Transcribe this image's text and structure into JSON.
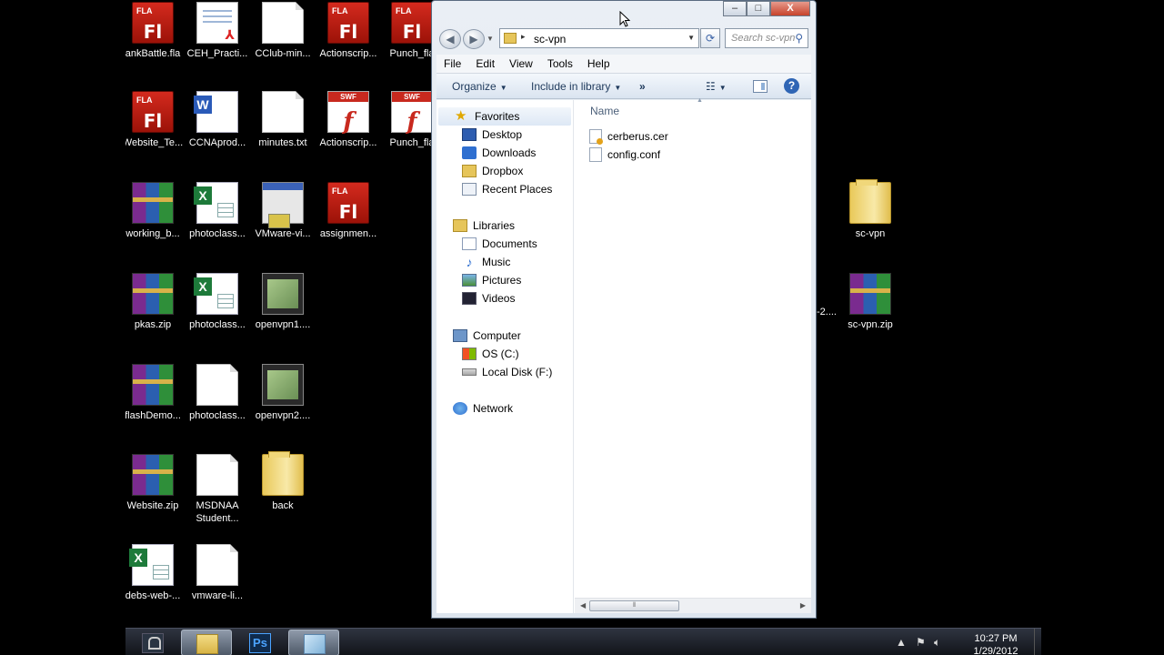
{
  "desktop": {
    "icons": [
      {
        "label": "ankBattle.fla",
        "type": "fla"
      },
      {
        "label": "CEH_Practi...",
        "type": "pdf"
      },
      {
        "label": "CClub-min...",
        "type": "txt"
      },
      {
        "label": "Actionscrip...",
        "type": "fla"
      },
      {
        "label": "Punch_fla",
        "type": "fla"
      },
      {
        "label": "Website_Te...",
        "type": "fla"
      },
      {
        "label": "CCNAprod...",
        "type": "doc"
      },
      {
        "label": "minutes.txt",
        "type": "txt"
      },
      {
        "label": "Actionscrip...",
        "type": "swf"
      },
      {
        "label": "Punch_fla",
        "type": "swf"
      },
      {
        "label": "working_b...",
        "type": "zip"
      },
      {
        "label": "photoclass...",
        "type": "xls"
      },
      {
        "label": "VMware-vi...",
        "type": "vm"
      },
      {
        "label": "assignmen...",
        "type": "fla"
      },
      {
        "label": "pkas.zip",
        "type": "zip"
      },
      {
        "label": "photoclass...",
        "type": "xls"
      },
      {
        "label": "openvpn1....",
        "type": "film"
      },
      {
        "label": "flashDemo...",
        "type": "zip"
      },
      {
        "label": "photoclass...",
        "type": "txt"
      },
      {
        "label": "openvpn2....",
        "type": "film"
      },
      {
        "label": "Website.zip",
        "type": "zip"
      },
      {
        "label": "MSDNAA Student...",
        "type": "txt"
      },
      {
        "label": "back",
        "type": "folder"
      },
      {
        "label": "debs-web-...",
        "type": "xls"
      },
      {
        "label": "vmware-li...",
        "type": "txt"
      },
      {
        "label": "sc-vpn",
        "type": "folder"
      },
      {
        "label": "-2....",
        "type": "partial"
      },
      {
        "label": "sc-vpn.zip",
        "type": "zip"
      }
    ],
    "fla_badge": "FLA",
    "fla_mark": "Fl",
    "swf_badge": "SWF",
    "swf_mark": "f",
    "word_mark": "W",
    "excel_mark": "X"
  },
  "explorer": {
    "caption": {
      "minimize": "–",
      "maximize": "□",
      "close": "X"
    },
    "address": {
      "path": "sc-vpn",
      "separator": "▸"
    },
    "search": {
      "placeholder": "Search sc-vpn"
    },
    "menu": [
      "File",
      "Edit",
      "View",
      "Tools",
      "Help"
    ],
    "commands": {
      "organize": "Organize",
      "include": "Include in library",
      "more": "»",
      "help": "?"
    },
    "nav": {
      "favorites_header": "Favorites",
      "favorites": [
        "Desktop",
        "Downloads",
        "Dropbox",
        "Recent Places"
      ],
      "libraries_header": "Libraries",
      "libraries": [
        "Documents",
        "Music",
        "Pictures",
        "Videos"
      ],
      "computer_header": "Computer",
      "drives": [
        "OS (C:)",
        "Local Disk (F:)"
      ],
      "network": "Network"
    },
    "column_name": "Name",
    "files": [
      "cerberus.cer",
      "config.conf"
    ]
  },
  "taskbar": {
    "ps_label": "Ps",
    "time": "10:27 PM",
    "date": "1/29/2012"
  },
  "colors": {
    "accent": "#2f65b5",
    "window_bg": "#dde5ee",
    "taskbar": "#11141a"
  }
}
